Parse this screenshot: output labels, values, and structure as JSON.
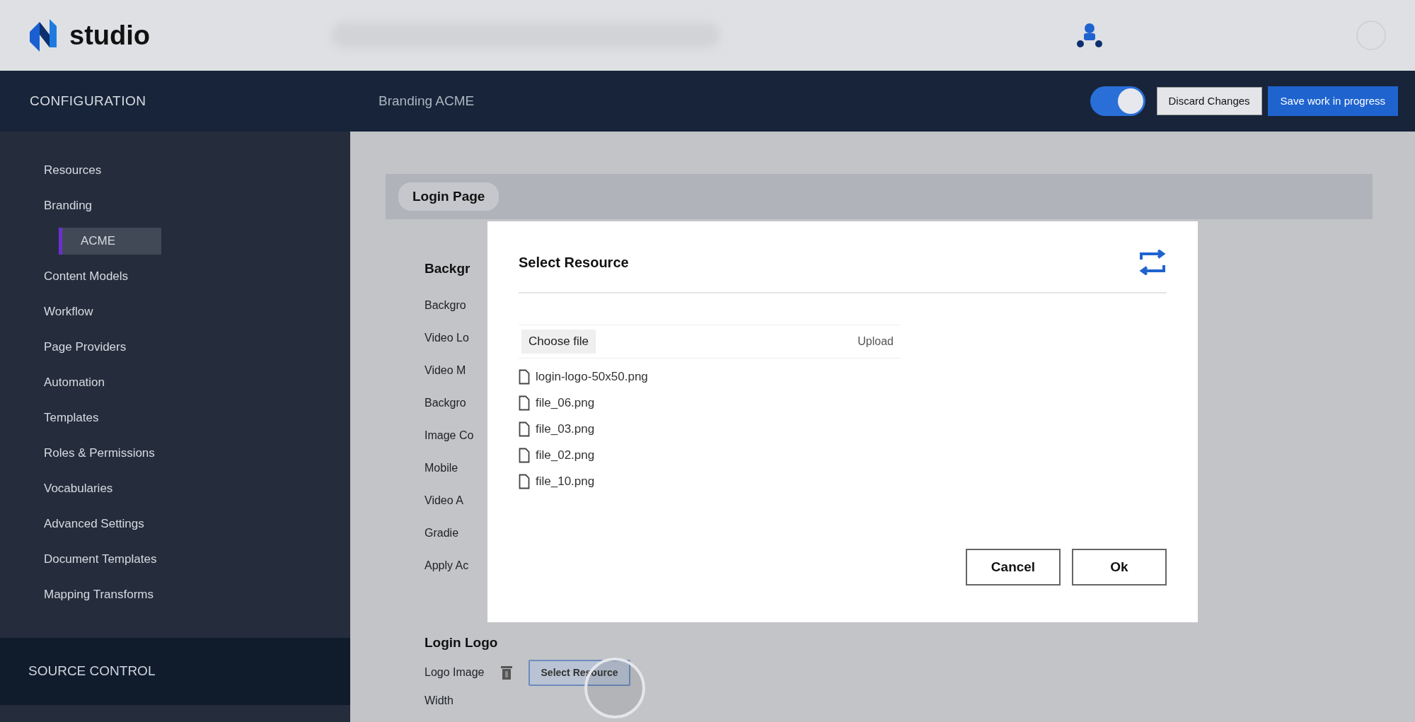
{
  "header": {
    "logo_text": "studio"
  },
  "config_bar": {
    "section": "CONFIGURATION",
    "breadcrumb": "Branding ACME",
    "toggle": {
      "on": true
    },
    "buttons": [
      {
        "label": "Discard Changes",
        "kind": "secondary"
      },
      {
        "label": "Save work in progress",
        "kind": "primary"
      }
    ]
  },
  "sidebar": {
    "items": [
      {
        "label": "Resources",
        "selected": false
      },
      {
        "label": "Branding",
        "selected": false,
        "children": [
          {
            "label": "ACME",
            "selected": true
          }
        ]
      },
      {
        "label": "Content Models",
        "selected": false
      },
      {
        "label": "Workflow",
        "selected": false
      },
      {
        "label": "Page Providers",
        "selected": false
      },
      {
        "label": "Automation",
        "selected": false
      },
      {
        "label": "Templates",
        "selected": false
      },
      {
        "label": "Roles & Permissions",
        "selected": false
      },
      {
        "label": "Vocabularies",
        "selected": false
      },
      {
        "label": "Advanced Settings",
        "selected": false
      },
      {
        "label": "Document Templates",
        "selected": false
      },
      {
        "label": "Mapping Transforms",
        "selected": false
      }
    ],
    "footer": "SOURCE CONTROL"
  },
  "page": {
    "section_title": "Login Page",
    "background": {
      "heading": "Backgr",
      "fields": [
        "Backgro",
        "Video Lo",
        "Video M",
        "Backgro",
        "Image Co",
        "Mobile",
        "Video A",
        "Gradie",
        "Apply Ac"
      ]
    },
    "login_logo": {
      "heading": "Login Logo",
      "field_label": "Logo Image",
      "button": "Select Resource",
      "next_label": "Width"
    }
  },
  "dialog": {
    "title": "Select Resource",
    "file_button": "Choose file",
    "upload": "Upload",
    "files": [
      "login-logo-50x50.png",
      "file_06.png",
      "file_03.png",
      "file_02.png",
      "file_10.png"
    ],
    "buttons": [
      "Cancel",
      "Ok"
    ]
  }
}
